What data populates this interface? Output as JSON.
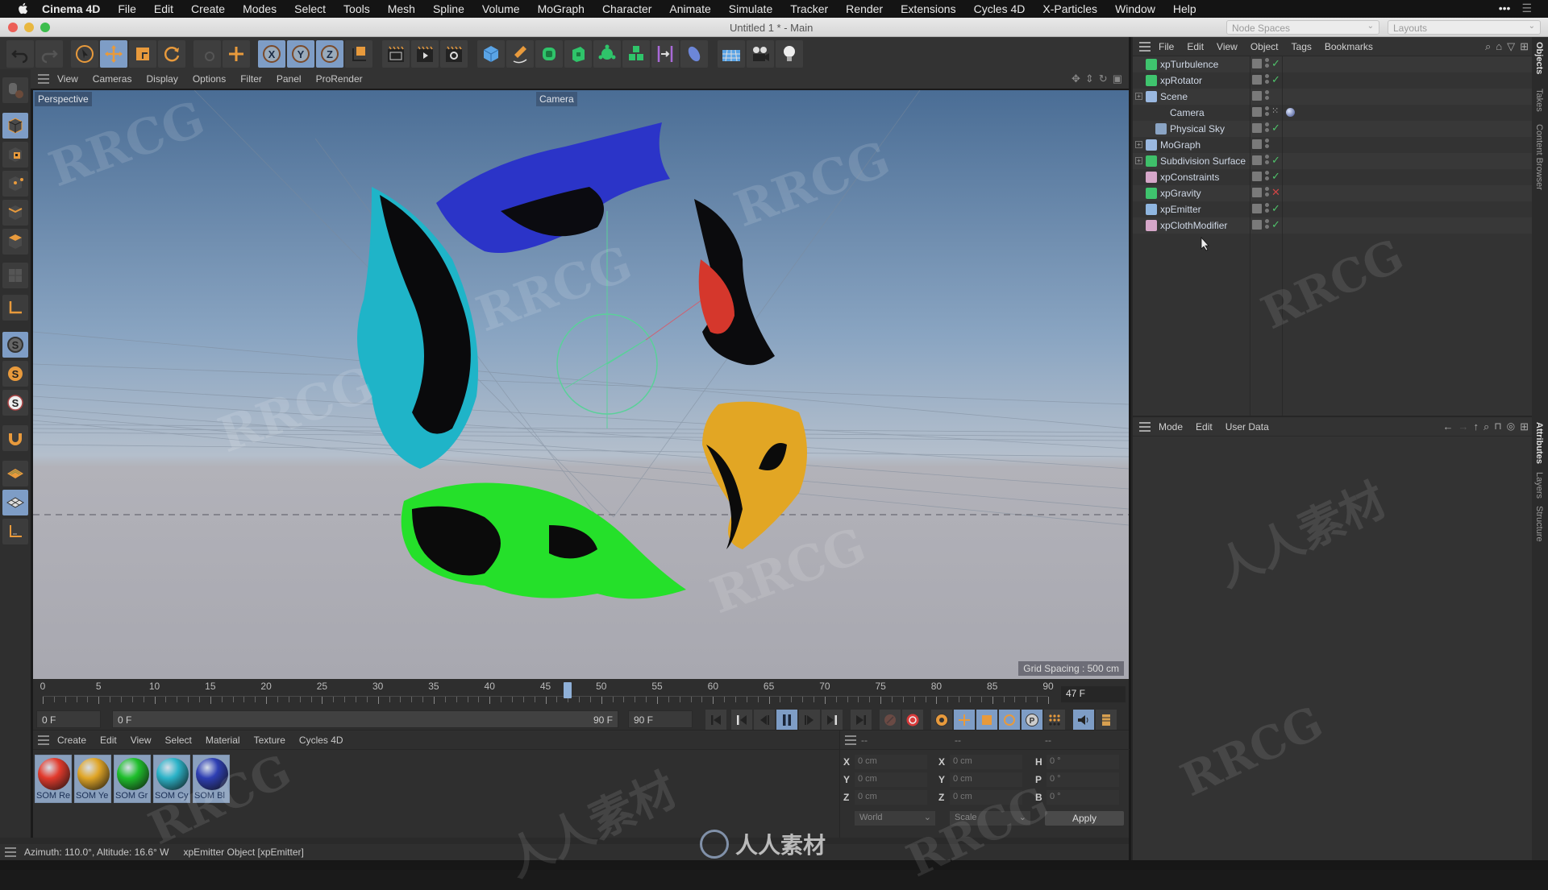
{
  "mac_menu": {
    "app": "Cinema 4D",
    "items": [
      "File",
      "Edit",
      "Create",
      "Modes",
      "Select",
      "Tools",
      "Mesh",
      "Spline",
      "Volume",
      "MoGraph",
      "Character",
      "Animate",
      "Simulate",
      "Tracker",
      "Render",
      "Extensions",
      "Cycles 4D",
      "X-Particles",
      "Window",
      "Help"
    ]
  },
  "window": {
    "title": "Untitled 1 * - Main",
    "node_spaces": "Node Spaces",
    "layouts": "Layouts"
  },
  "toolbar": {
    "icons": [
      "undo-icon",
      "redo-icon",
      "select-icon",
      "move-icon",
      "scale-icon",
      "rotate-icon",
      "recent-tool-icon",
      "live-move-icon",
      "x-axis-icon",
      "y-axis-icon",
      "z-axis-icon",
      "coordinate-system-icon",
      "render-region-icon",
      "render-view-icon",
      "render-settings-icon",
      "cube-icon",
      "pen-icon",
      "subdivision-icon",
      "extrude-icon",
      "cloner-icon",
      "mograph-icon",
      "deformer-icon",
      "field-icon",
      "floor-icon",
      "camera-icon",
      "light-icon"
    ]
  },
  "viewport_menu": {
    "items": [
      "View",
      "Cameras",
      "Display",
      "Options",
      "Filter",
      "Panel",
      "ProRender"
    ]
  },
  "viewport": {
    "view_name": "Perspective",
    "camera_name": "Camera",
    "grid_spacing": "Grid Spacing : 500 cm"
  },
  "timeline": {
    "ticks": [
      "0",
      "5",
      "10",
      "15",
      "20",
      "25",
      "30",
      "35",
      "40",
      "45",
      "50",
      "55",
      "60",
      "65",
      "70",
      "75",
      "80",
      "85",
      "90"
    ],
    "start": 0,
    "end": 90,
    "current_frame": 47,
    "current_frame_label": "47 F"
  },
  "transport": {
    "start_field": "0 F",
    "range_start": "0 F",
    "range_end": "90 F",
    "end_field": "90 F"
  },
  "material_manager": {
    "menu": [
      "Create",
      "Edit",
      "View",
      "Select",
      "Material",
      "Texture",
      "Cycles 4D"
    ],
    "materials": [
      {
        "label": "SOM Re",
        "color": "#e23a2c"
      },
      {
        "label": "SOM Ye",
        "color": "#e0a526"
      },
      {
        "label": "SOM Gr",
        "color": "#1fbf2c"
      },
      {
        "label": "SOM Cy",
        "color": "#2bb3c8"
      },
      {
        "label": "SOM Bl",
        "color": "#2e3fb3"
      }
    ]
  },
  "coordinates": {
    "headers": [
      "--",
      "--",
      "--"
    ],
    "position": [
      {
        "axis": "X",
        "value": "0 cm"
      },
      {
        "axis": "Y",
        "value": "0 cm"
      },
      {
        "axis": "Z",
        "value": "0 cm"
      }
    ],
    "size": [
      {
        "axis": "X",
        "value": "0 cm"
      },
      {
        "axis": "Y",
        "value": "0 cm"
      },
      {
        "axis": "Z",
        "value": "0 cm"
      }
    ],
    "rotation": [
      {
        "axis": "H",
        "value": "0 °"
      },
      {
        "axis": "P",
        "value": "0 °"
      },
      {
        "axis": "B",
        "value": "0 °"
      }
    ],
    "space": "World",
    "mode": "Scale",
    "apply": "Apply"
  },
  "status_bar": {
    "text": "Azimuth: 110.0°, Altitude: 16.6°  W",
    "object": "xpEmitter Object [xpEmitter]"
  },
  "object_manager": {
    "menu": [
      "File",
      "Edit",
      "View",
      "Object",
      "Tags",
      "Bookmarks"
    ],
    "objects": [
      {
        "name": "xpTurbulence",
        "indent": 0,
        "icon_color": "#3fc46e",
        "status": "check",
        "expandable": false
      },
      {
        "name": "xpRotator",
        "indent": 0,
        "icon_color": "#3fc46e",
        "status": "check",
        "expandable": false
      },
      {
        "name": "Scene",
        "indent": 0,
        "icon_color": "#9ab8e0",
        "status": "none",
        "expandable": true
      },
      {
        "name": "Camera",
        "indent": 1,
        "icon_color": "#333333",
        "status": "target",
        "expandable": false
      },
      {
        "name": "Physical Sky",
        "indent": 1,
        "icon_color": "#8aa4c4",
        "status": "check",
        "expandable": false
      },
      {
        "name": "MoGraph",
        "indent": 0,
        "icon_color": "#9ab8e0",
        "status": "none",
        "expandable": true
      },
      {
        "name": "Subdivision Surface",
        "indent": 0,
        "icon_color": "#3fbf6a",
        "status": "check",
        "expandable": true
      },
      {
        "name": "xpConstraints",
        "indent": 0,
        "icon_color": "#d6a7c9",
        "status": "check",
        "expandable": false
      },
      {
        "name": "xpGravity",
        "indent": 0,
        "icon_color": "#3fc46e",
        "status": "x",
        "expandable": false
      },
      {
        "name": "xpEmitter",
        "indent": 0,
        "icon_color": "#8fb6e0",
        "status": "check",
        "expandable": false
      },
      {
        "name": "xpClothModifier",
        "indent": 0,
        "icon_color": "#d6a7c9",
        "status": "check",
        "expandable": false
      }
    ]
  },
  "attributes": {
    "menu": [
      "Mode",
      "Edit",
      "User Data"
    ]
  },
  "side_tabs": {
    "top": [
      "Objects",
      "Takes",
      "Content Browser"
    ],
    "bottom": [
      "Attributes",
      "Layers",
      "Structure"
    ]
  },
  "watermarks": {
    "rrcg": "RRCG",
    "cn": "人人素材"
  }
}
